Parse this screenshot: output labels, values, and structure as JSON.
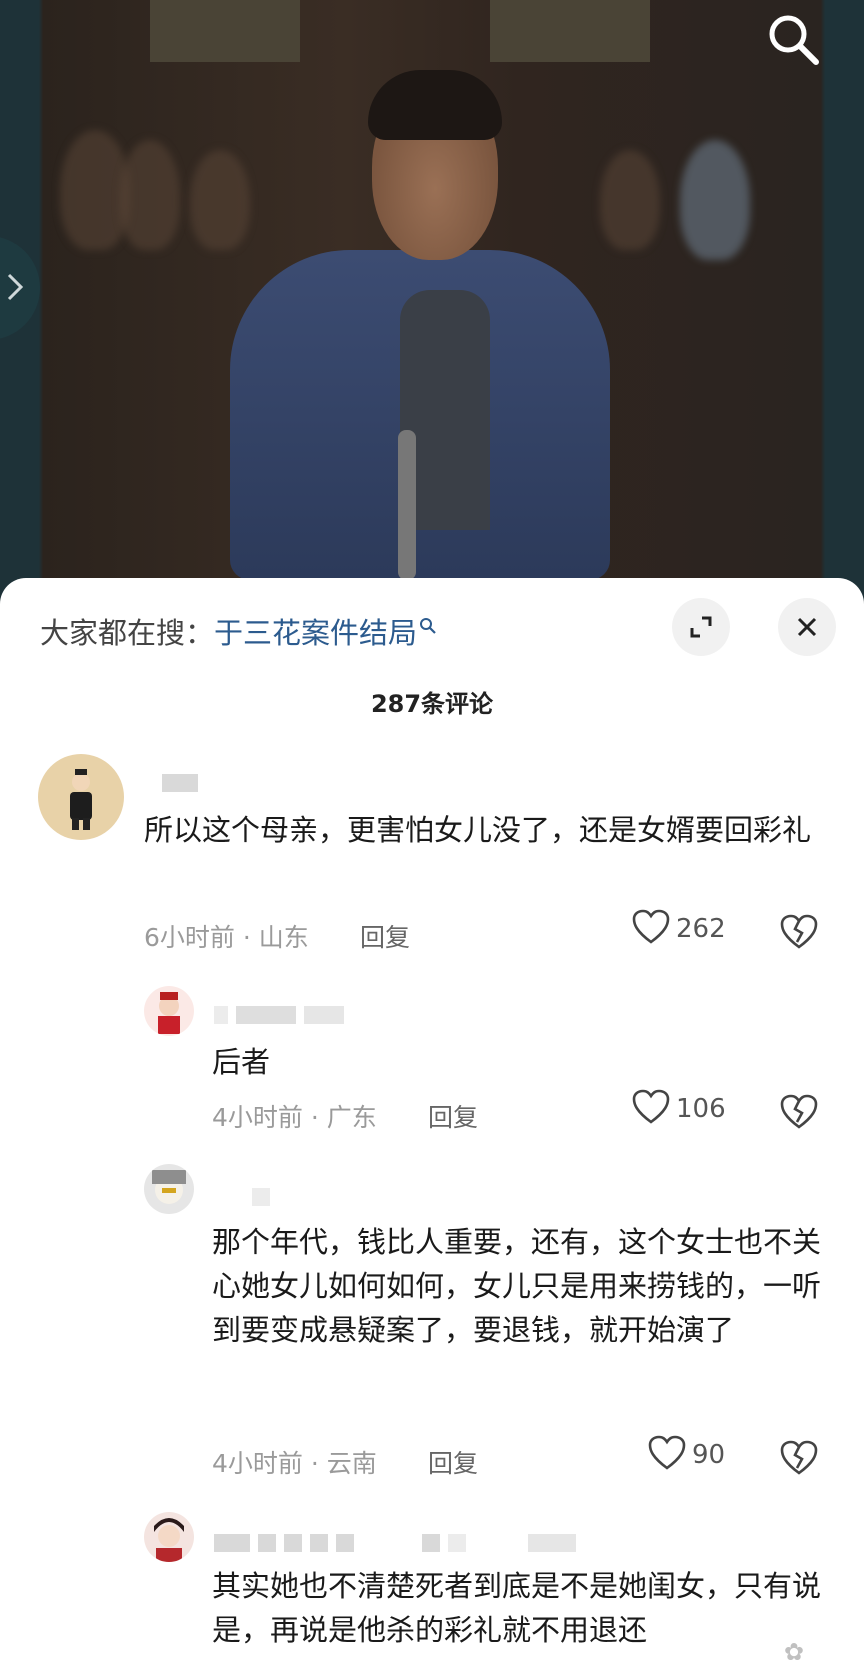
{
  "hot_search": {
    "label": "大家都在搜：",
    "keyword": "于三花案件结局"
  },
  "comment_count": "287条评论",
  "comments": [
    {
      "text": "所以这个母亲，更害怕女儿没了，还是女婿要回彩礼",
      "meta": "6小时前 · 山东",
      "reply": "回复",
      "likes": "262"
    },
    {
      "text": "后者",
      "meta": "4小时前 · 广东",
      "reply": "回复",
      "likes": "106"
    },
    {
      "text": "那个年代，钱比人重要，还有，这个女士也不关心她女儿如何如何，女儿只是用来捞钱的，一听到要变成悬疑案了，要退钱，就开始演了",
      "meta": "4小时前 · 云南",
      "reply": "回复",
      "likes": "90"
    },
    {
      "text": "其实她也不清楚死者到底是不是她闺女，只有说是，再说是他杀的彩礼就不用退还",
      "meta": "",
      "reply": "",
      "likes": ""
    }
  ],
  "icons": {
    "search": "search-icon",
    "expand": "expand-icon",
    "close": "close-icon",
    "like": "heart-icon",
    "dislike": "broken-heart-icon",
    "side": "chevron-right-icon"
  },
  "colors": {
    "keyword": "#2c5b8e",
    "meta": "#9a9a9a"
  }
}
